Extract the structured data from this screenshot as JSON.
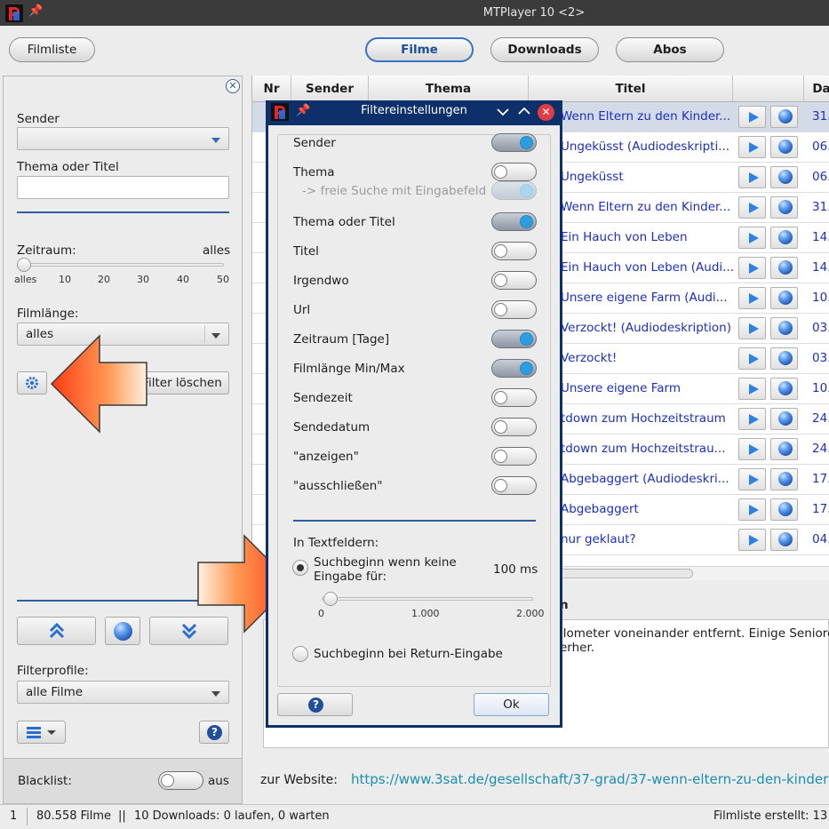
{
  "window": {
    "title": "MTPlayer 10 <2>"
  },
  "toolbar": {
    "filmliste": "Filmliste",
    "tabs": [
      "Filme",
      "Downloads",
      "Abos"
    ]
  },
  "filter_panel": {
    "sender_label": "Sender",
    "thema_titel_label": "Thema oder Titel",
    "thema_titel_value": "",
    "zeitraum_label": "Zeitraum:",
    "zeitraum_value": "alles",
    "zeitraum_ticks": [
      "alles",
      "10",
      "20",
      "30",
      "40",
      "50"
    ],
    "filmlaenge_label": "Filmlänge:",
    "filmlaenge_value": "alles",
    "filter_loeschen": "Filter löschen",
    "filterprofile_label": "Filterprofile:",
    "filterprofile_value": "alle Filme",
    "blacklist_label": "Blacklist:",
    "blacklist_state": "aus"
  },
  "table": {
    "columns": [
      "Nr",
      "Sender",
      "Thema",
      "Titel",
      "",
      "Da"
    ],
    "rows": [
      {
        "titel": "Wenn Eltern zu den Kinder...",
        "datum": "31."
      },
      {
        "titel": "Ungeküsst (Audiodeskripti...",
        "datum": "06."
      },
      {
        "titel": "Ungeküsst",
        "datum": "06."
      },
      {
        "titel": "Wenn Eltern zu den Kinder...",
        "datum": "31."
      },
      {
        "titel": "Ein Hauch von Leben",
        "datum": "14."
      },
      {
        "titel": "Ein Hauch von Leben (Audi...",
        "datum": "14."
      },
      {
        "titel": "Unsere eigene Farm (Audi...",
        "datum": "10."
      },
      {
        "titel": "Verzockt! (Audiodeskription)",
        "datum": "03."
      },
      {
        "titel": "Verzockt!",
        "datum": "03."
      },
      {
        "titel": "Unsere eigene Farm",
        "datum": "10."
      },
      {
        "titel": "tdown zum Hochzeitstraum",
        "datum": "24."
      },
      {
        "titel": "tdown zum Hochzeitstrau...",
        "datum": "24."
      },
      {
        "titel": "Abgebaggert (Audiodeskri...",
        "datum": "17."
      },
      {
        "titel": "Abgebaggert",
        "datum": "17."
      },
      {
        "titel": "nur geklaut?",
        "datum": "04."
      }
    ]
  },
  "description": {
    "heading_partial": "n",
    "line1": "ilometer voneinander entfernt. Einige Seniore",
    "line2": "erher.",
    "website_label": "zur Website:",
    "website_url": "https://www.3sat.de/gesellschaft/37-grad/37-wenn-eltern-zu-den-kinder"
  },
  "statusbar": {
    "count": "1",
    "filme": "80.558 Filme",
    "sep": "||",
    "downloads": "10 Downloads: 0 laufen, 0 warten",
    "erstellt": "Filmliste erstellt: 13"
  },
  "dialog": {
    "title": "Filtereinstellungen",
    "filters": [
      {
        "label": "Sender",
        "state": "on"
      },
      {
        "label": "Thema",
        "state": "off"
      },
      {
        "label": "-> freie Suche mit Eingabefeld",
        "state": "disabled"
      },
      {
        "label": "Thema oder Titel",
        "state": "on"
      },
      {
        "label": "Titel",
        "state": "off"
      },
      {
        "label": "Irgendwo",
        "state": "off"
      },
      {
        "label": "Url",
        "state": "off"
      },
      {
        "label": "Zeitraum [Tage]",
        "state": "on"
      },
      {
        "label": "Filmlänge Min/Max",
        "state": "on"
      },
      {
        "label": "Sendezeit",
        "state": "off"
      },
      {
        "label": "Sendedatum",
        "state": "off"
      },
      {
        "label": "\"anzeigen\"",
        "state": "off"
      },
      {
        "label": "\"ausschließen\"",
        "state": "off"
      }
    ],
    "textfelder_label": "In Textfeldern:",
    "radio1_label_line1": "Suchbeginn wenn keine",
    "radio1_label_line2": "Eingabe für:",
    "radio1_value": "100 ms",
    "slider_ticks": [
      "0",
      "1.000",
      "2.000"
    ],
    "slider_value": 100,
    "radio2_label": "Suchbeginn bei Return-Eingabe",
    "ok_label": "Ok"
  },
  "colors": {
    "accent": "#2c9ee0",
    "link": "#1a2fc1",
    "dialog_border": "#0d2f6a",
    "arrow": "#ff5a1e"
  }
}
